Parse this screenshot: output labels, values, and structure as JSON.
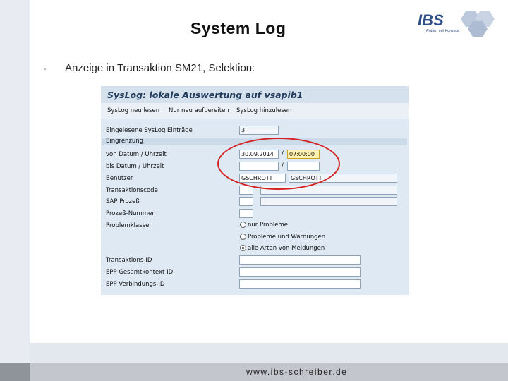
{
  "slide": {
    "title": "System Log",
    "intro": "Anzeige in Transaktion SM21, Selektion:",
    "bullet": "-",
    "footer_url": "www.ibs-schreiber.de"
  },
  "logo": {
    "text": "IBS",
    "tagline": "Prüfen mit Konzept"
  },
  "sap": {
    "window_title": "SysLog: lokale Auswertung auf vsapib1",
    "toolbar": [
      "SysLog neu lesen",
      "Nur neu aufbereiten",
      "SysLog hinzulesen"
    ],
    "entries_label": "Eingelesene SysLog Einträge",
    "entries_value": "3",
    "group_label": "Eingrenzung",
    "from_label": "von Datum / Uhrzeit",
    "from_date": "30.09.2014",
    "from_time": "07:00:00",
    "to_label": "bis Datum / Uhrzeit",
    "to_date": "",
    "to_time": "",
    "slash": "/",
    "user_label": "Benutzer",
    "user_value": "GSCHROTT",
    "user_display": "GSCHROTT",
    "tcode_label": "Transaktionscode",
    "process_label": "SAP Prozeß",
    "process_no_label": "Prozeß-Nummer",
    "problem_label": "Problemklassen",
    "radios": [
      {
        "label": "nur Probleme",
        "selected": false
      },
      {
        "label": "Probleme und Warnungen",
        "selected": false
      },
      {
        "label": "alle Arten von Meldungen",
        "selected": true
      }
    ],
    "trans_id_label": "Transaktions-ID",
    "epp_context_label": "EPP Gesamtkontext ID",
    "epp_connection_label": "EPP Verbindungs-ID"
  },
  "colors": {
    "accent": "#d42020",
    "sap_bg": "#dfe9f3",
    "sap_title": "#223b5a",
    "logo_blue": "#2f4d86"
  }
}
